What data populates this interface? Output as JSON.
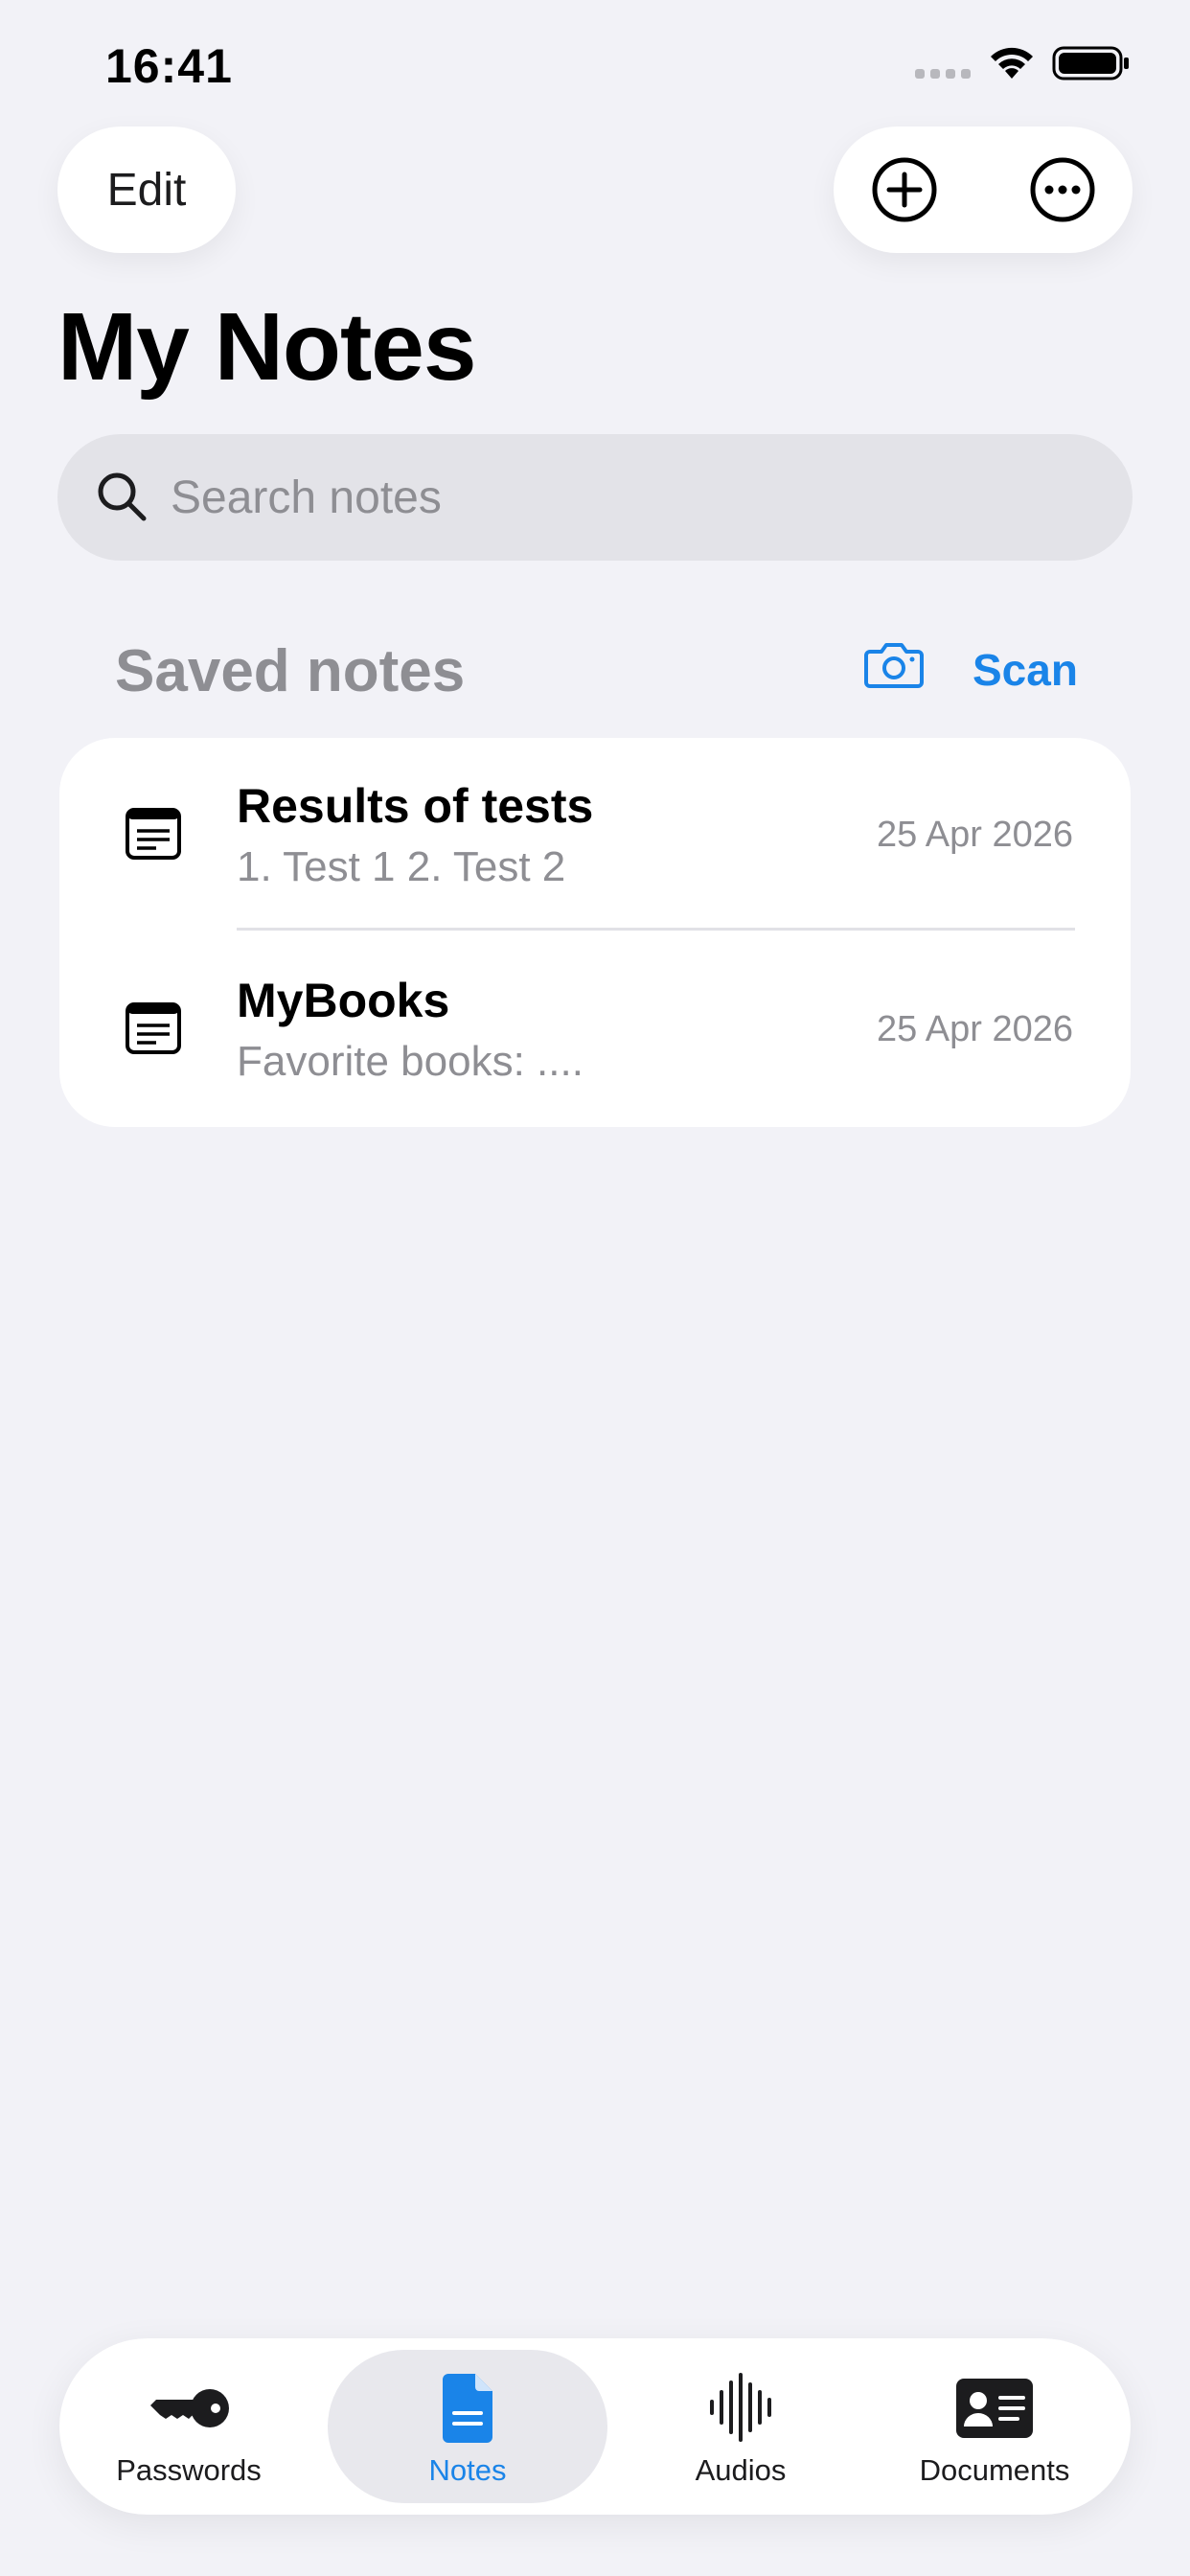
{
  "status_bar": {
    "time": "16:41"
  },
  "toolbar": {
    "edit_label": "Edit",
    "add_icon": "plus-circle-icon",
    "more_icon": "ellipsis-circle-icon"
  },
  "page_title": "My Notes",
  "search": {
    "placeholder": "Search notes",
    "value": ""
  },
  "section": {
    "title": "Saved notes",
    "scan_label": "Scan",
    "scan_icon": "camera-icon"
  },
  "notes": [
    {
      "title": "Results of tests",
      "preview": "1. Test 1 2. Test 2",
      "date": "25 Apr 2026"
    },
    {
      "title": "MyBooks",
      "preview": "Favorite books: ....",
      "date": "25 Apr 2026"
    }
  ],
  "tabs": [
    {
      "label": "Passwords",
      "icon": "key-icon",
      "active": false
    },
    {
      "label": "Notes",
      "icon": "document-icon",
      "active": true
    },
    {
      "label": "Audios",
      "icon": "waveform-icon",
      "active": false
    },
    {
      "label": "Documents",
      "icon": "id-card-icon",
      "active": false
    }
  ],
  "colors": {
    "accent": "#1a84e8",
    "background": "#f2f2f7",
    "secondary_text": "#8e8e93"
  }
}
